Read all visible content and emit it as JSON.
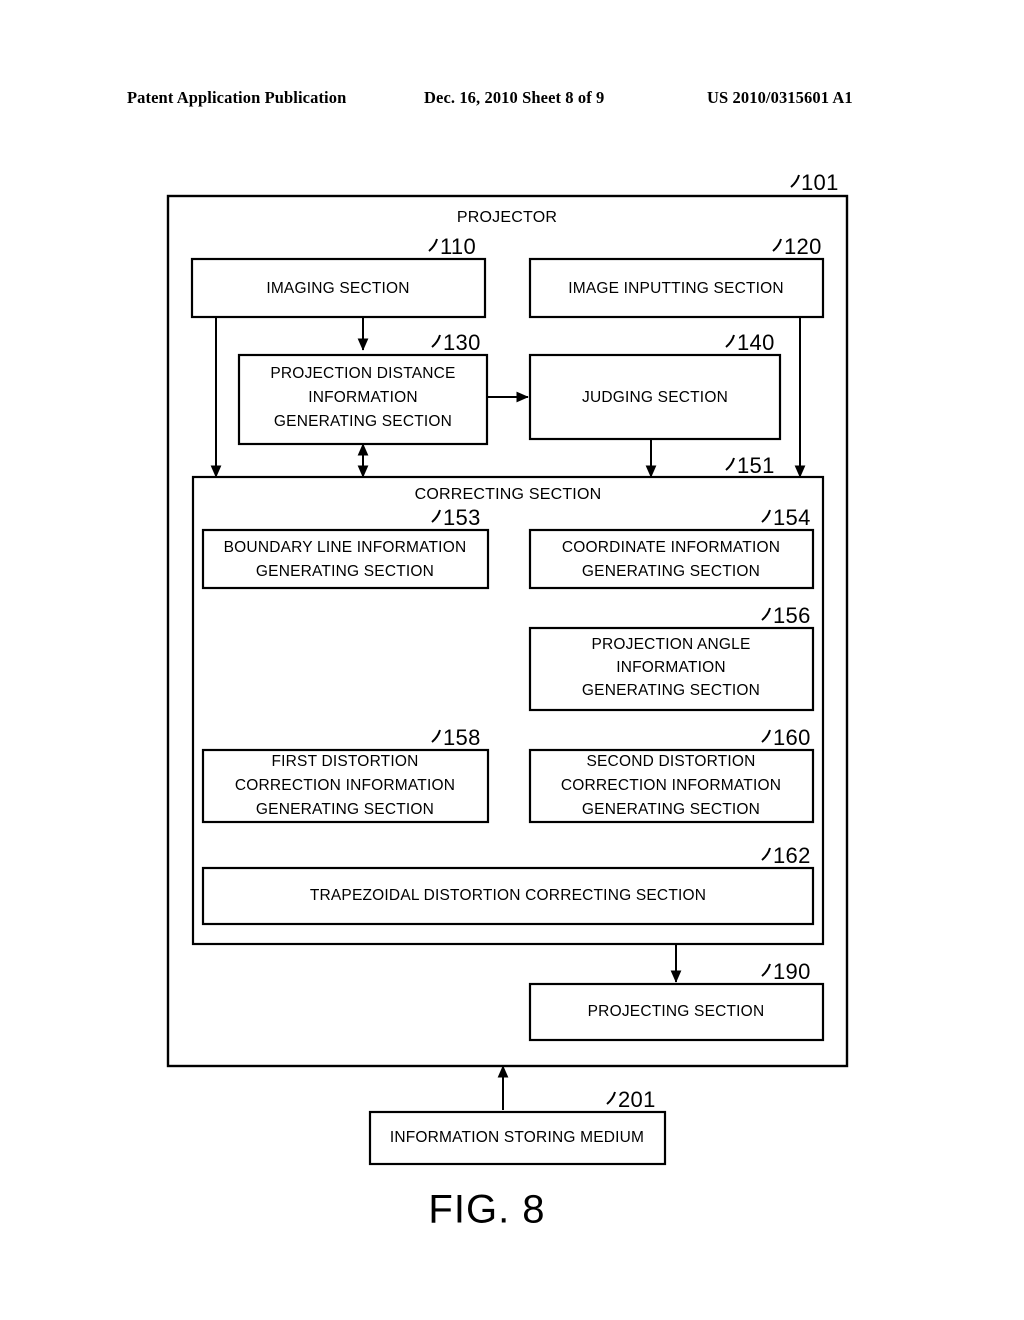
{
  "header": {
    "left": "Patent Application Publication",
    "middle": "Dec. 16, 2010  Sheet 8 of 9",
    "right": "US 2010/0315601 A1"
  },
  "figure": {
    "caption": "FIG. 8",
    "outer": {
      "title": "PROJECTOR",
      "ref": "101"
    },
    "correcting": {
      "title": "CORRECTING SECTION",
      "ref": "151"
    },
    "blocks": [
      {
        "id": "imaging",
        "ref": "110",
        "lines": [
          "IMAGING SECTION"
        ]
      },
      {
        "id": "image-inputting",
        "ref": "120",
        "lines": [
          "IMAGE INPUTTING SECTION"
        ]
      },
      {
        "id": "projection-distance",
        "ref": "130",
        "lines": [
          "PROJECTION DISTANCE",
          "INFORMATION",
          "GENERATING SECTION"
        ]
      },
      {
        "id": "judging",
        "ref": "140",
        "lines": [
          "JUDGING SECTION"
        ]
      },
      {
        "id": "boundary-line",
        "ref": "153",
        "lines": [
          "BOUNDARY LINE INFORMATION",
          "GENERATING SECTION"
        ]
      },
      {
        "id": "coordinate",
        "ref": "154",
        "lines": [
          "COORDINATE INFORMATION",
          "GENERATING SECTION"
        ]
      },
      {
        "id": "projection-angle",
        "ref": "156",
        "lines": [
          "PROJECTION ANGLE",
          "INFORMATION",
          "GENERATING SECTION"
        ]
      },
      {
        "id": "first-distortion",
        "ref": "158",
        "lines": [
          "FIRST DISTORTION",
          "CORRECTION INFORMATION",
          "GENERATING SECTION"
        ]
      },
      {
        "id": "second-distortion",
        "ref": "160",
        "lines": [
          "SECOND DISTORTION",
          "CORRECTION INFORMATION",
          "GENERATING SECTION"
        ]
      },
      {
        "id": "trapezoidal",
        "ref": "162",
        "lines": [
          "TRAPEZOIDAL DISTORTION CORRECTING SECTION"
        ]
      },
      {
        "id": "projecting",
        "ref": "190",
        "lines": [
          "PROJECTING SECTION"
        ]
      },
      {
        "id": "storing-medium",
        "ref": "201",
        "lines": [
          "INFORMATION STORING MEDIUM"
        ]
      }
    ]
  },
  "colors": {
    "ink": "#000000",
    "paper": "#ffffff"
  }
}
